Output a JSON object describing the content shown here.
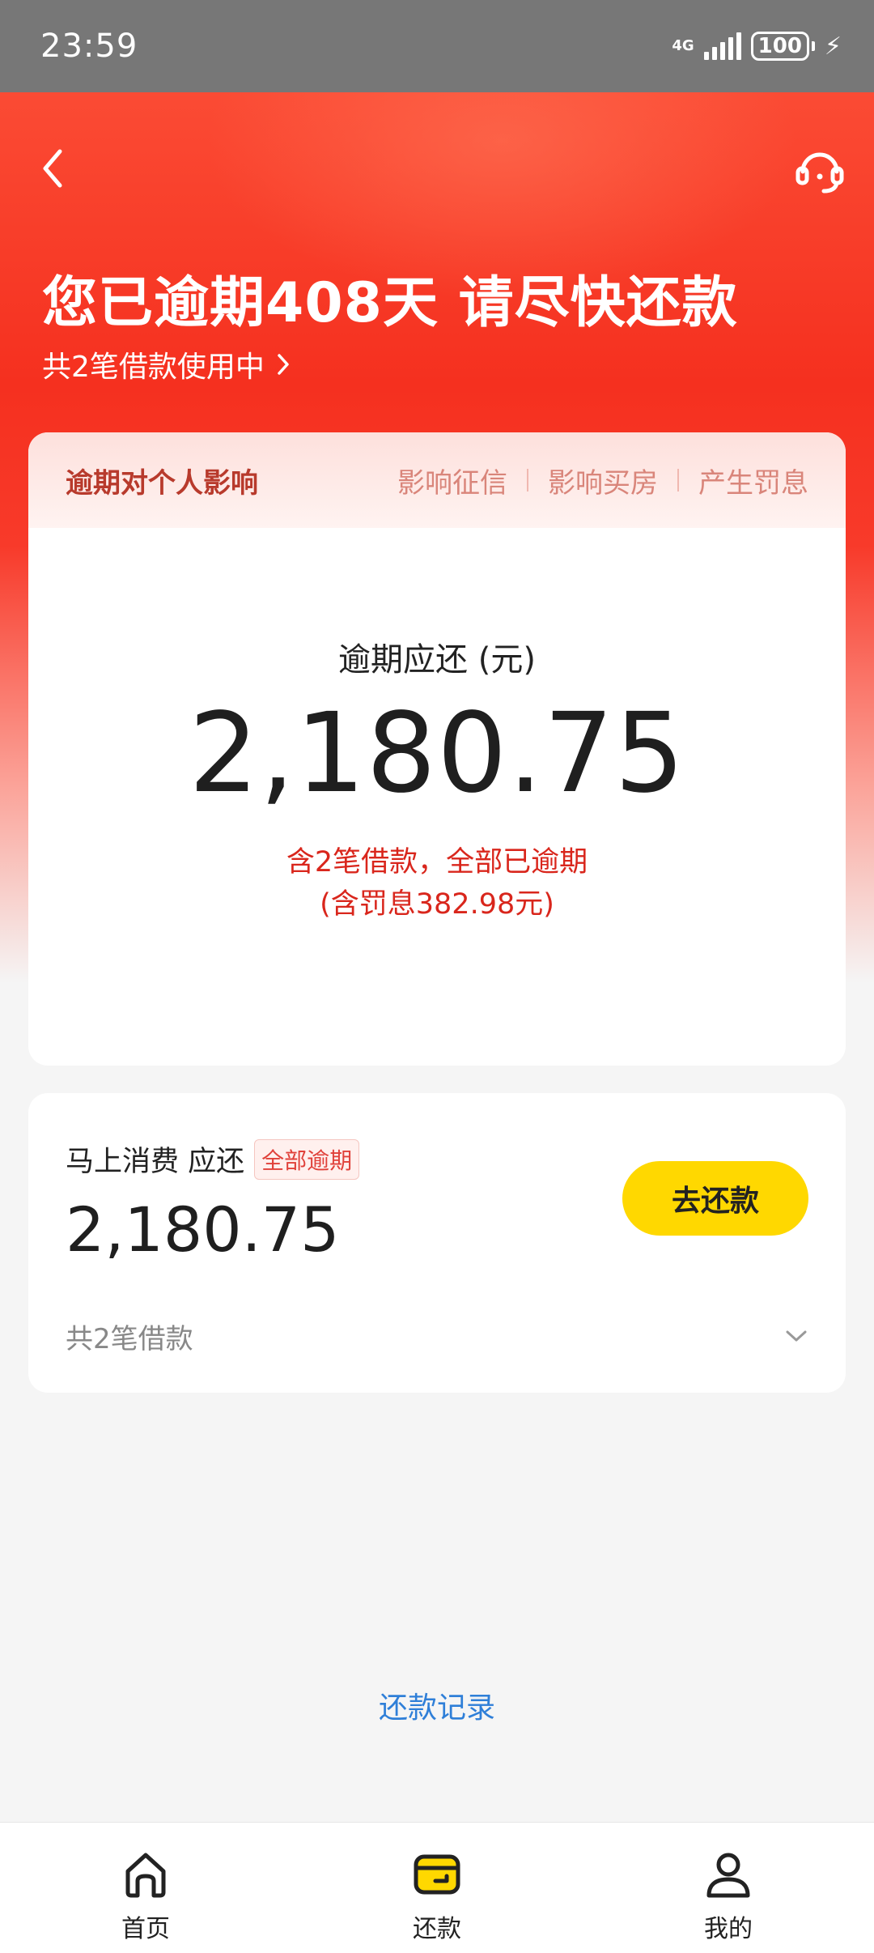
{
  "status_bar": {
    "time": "23:59",
    "network": "4G",
    "battery": "100"
  },
  "header": {
    "title": "您已逾期408天 请尽快还款",
    "subtitle": "共2笔借款使用中"
  },
  "impact_card": {
    "title": "逾期对个人影响",
    "tags": [
      "影响征信",
      "影响买房",
      "产生罚息"
    ],
    "amount_label": "逾期应还 (元)",
    "amount": "2,180.75",
    "note_line1": "含2笔借款，全部已逾期",
    "note_line2": "(含罚息382.98元)"
  },
  "loan_card": {
    "merchant_label": "马上消费 应还",
    "badge": "全部逾期",
    "amount": "2,180.75",
    "repay_button": "去还款",
    "loan_count": "共2笔借款"
  },
  "records_link": "还款记录",
  "tabbar": {
    "items": [
      {
        "label": "首页",
        "icon": "home-icon"
      },
      {
        "label": "还款",
        "icon": "wallet-icon"
      },
      {
        "label": "我的",
        "icon": "user-icon"
      }
    ]
  },
  "colors": {
    "brand_red": "#f5301f",
    "accent_yellow": "#ffd800",
    "link_blue": "#2f7fd8",
    "warning_red": "#d9261c"
  }
}
